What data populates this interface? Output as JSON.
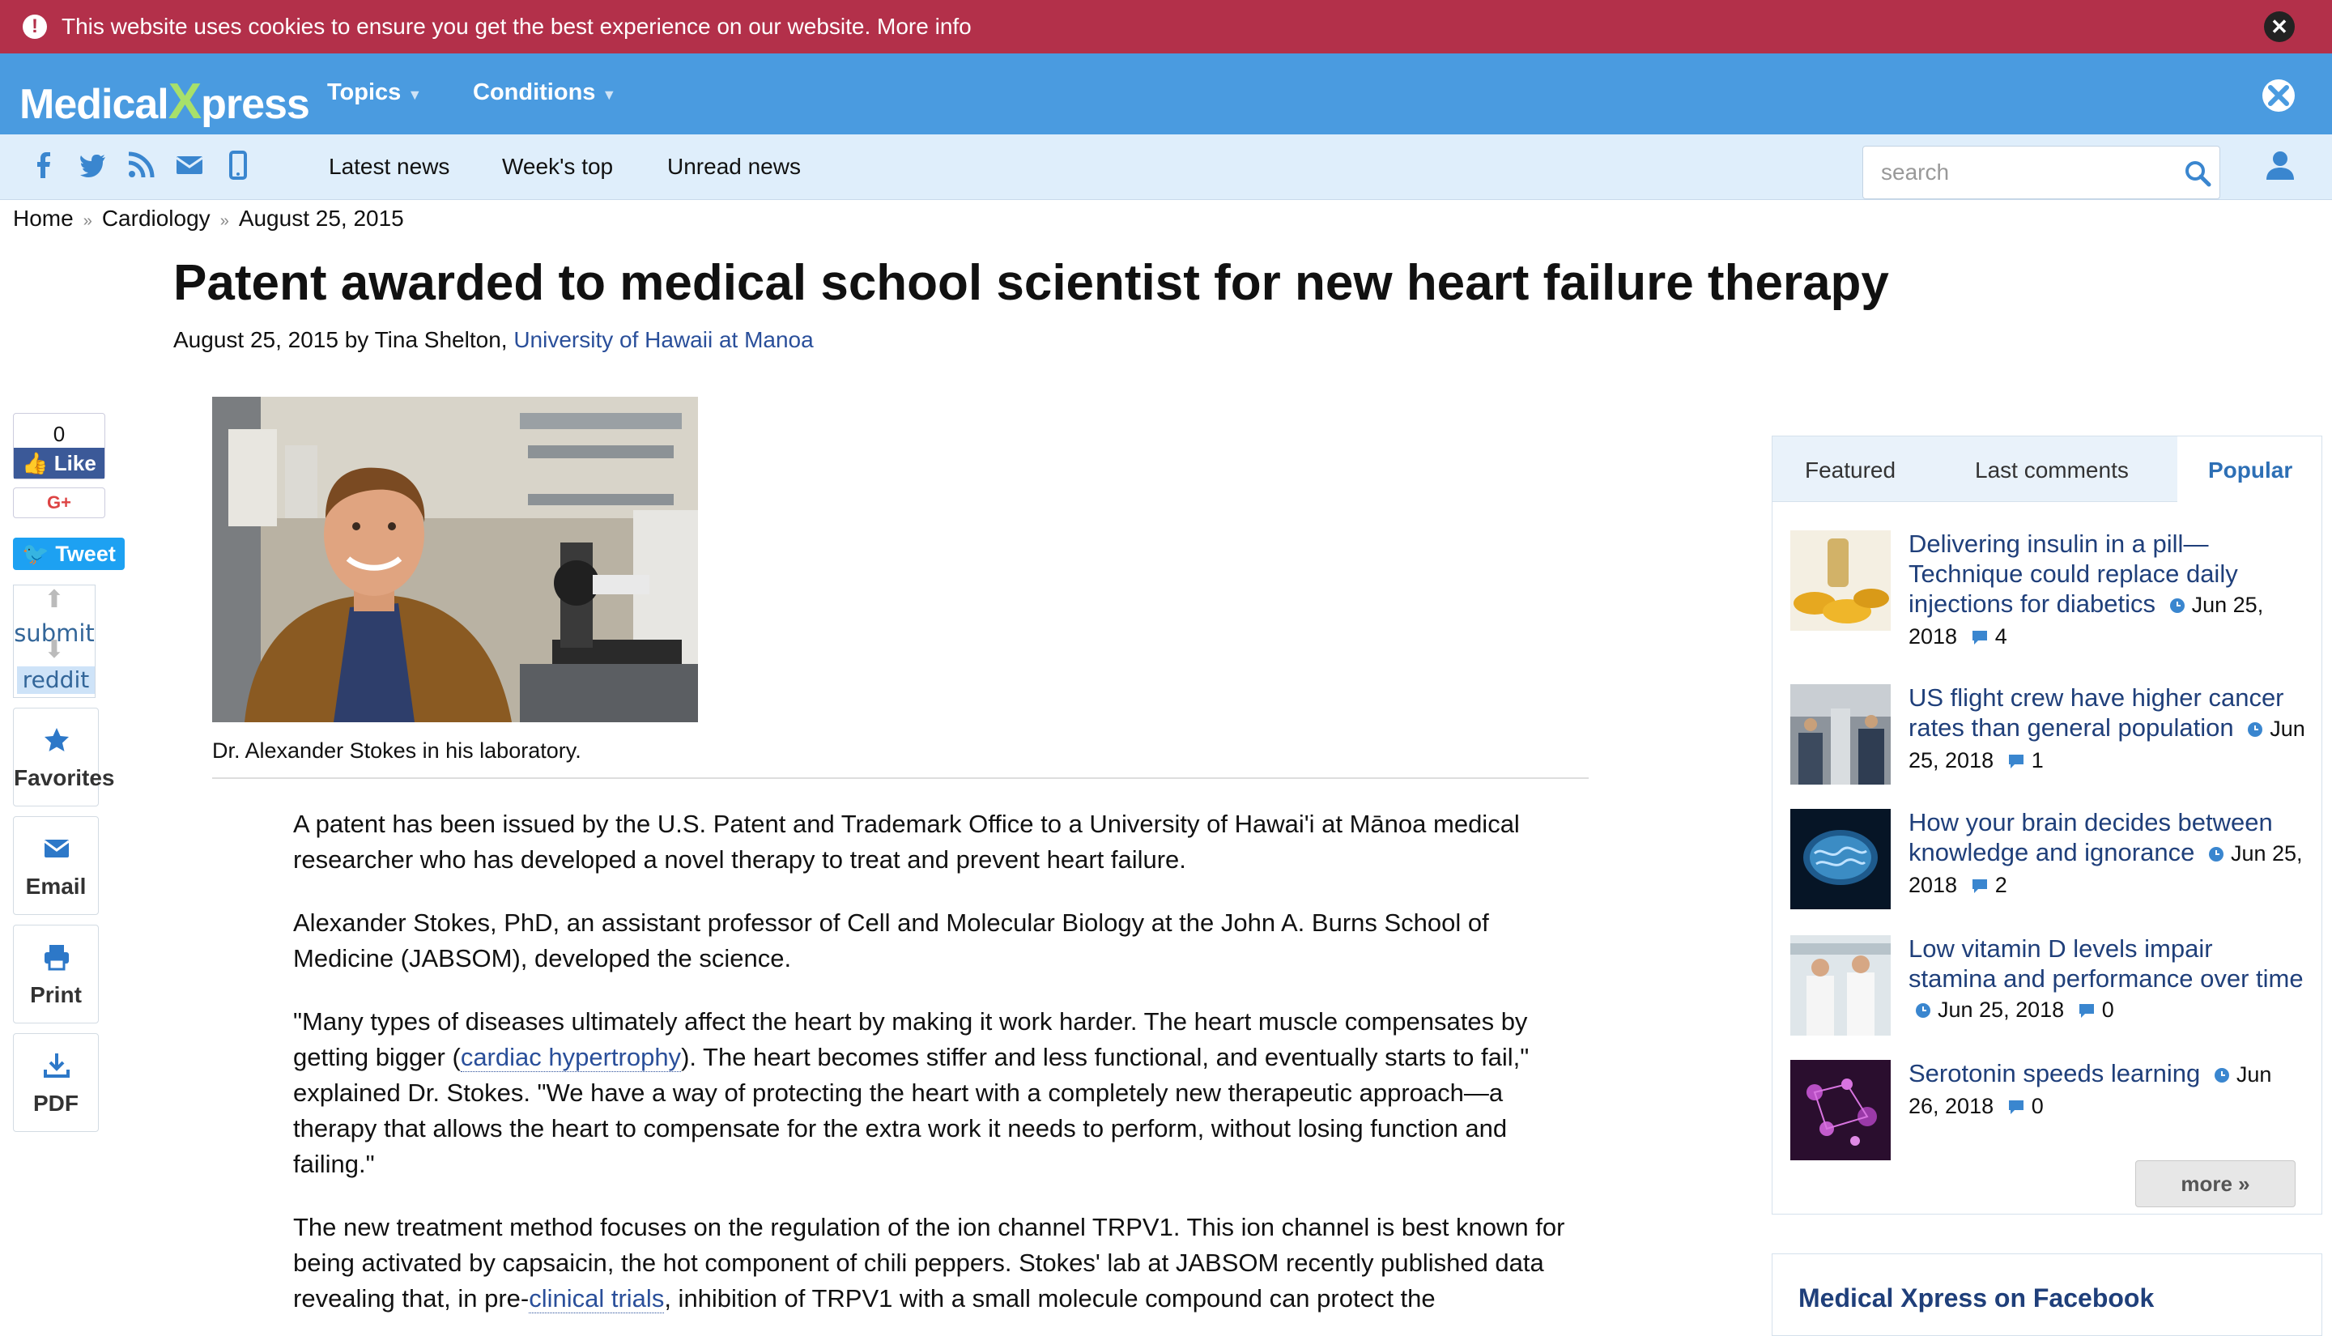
{
  "cookie_bar": {
    "message": "This website uses cookies to ensure you get the best experience on our website.",
    "more_info": "More info"
  },
  "header": {
    "logo_left": "Medical",
    "logo_x": "X",
    "logo_right": "press",
    "nav": [
      {
        "label": "Topics"
      },
      {
        "label": "Conditions"
      }
    ]
  },
  "subnav": {
    "links": [
      {
        "label": "Latest news"
      },
      {
        "label": "Week's top"
      },
      {
        "label": "Unread news"
      }
    ],
    "search_placeholder": "search",
    "social_icons": [
      "facebook-icon",
      "twitter-icon",
      "rss-icon",
      "mail-icon",
      "mobile-icon"
    ]
  },
  "breadcrumb": [
    "Home",
    "Cardiology",
    "August 25, 2015"
  ],
  "article": {
    "title": "Patent awarded to medical school scientist for new heart failure therapy",
    "date": "August 25, 2015",
    "by": "by",
    "author": "Tina Shelton,",
    "institution": "University of Hawaii at Manoa",
    "caption": "Dr. Alexander Stokes in his laboratory.",
    "p1": "A patent has been issued by the U.S. Patent and Trademark Office to a University of Hawai'i at Mānoa medical researcher who has developed a novel therapy to treat and prevent heart failure.",
    "p2": "Alexander Stokes, PhD, an assistant professor of Cell and Molecular Biology at the John A. Burns School of Medicine (JABSOM), developed the science.",
    "p3_a": "\"Many types of diseases ultimately affect the heart by making it work harder. The heart muscle compensates by getting bigger (",
    "p3_link": "cardiac hypertrophy",
    "p3_b": "). The heart becomes stiffer and less functional, and eventually starts to fail,\" explained Dr. Stokes. \"We have a way of protecting the heart with a completely new therapeutic approach—a therapy that allows the heart to compensate for the extra work it needs to perform, without losing function and failing.\"",
    "p4_a": "The new treatment method focuses on the regulation of the ion channel TRPV1. This ion channel is best known for being activated by capsaicin, the hot component of chili peppers. Stokes' lab at JABSOM recently published data revealing that, in pre-",
    "p4_link": "clinical trials",
    "p4_b": ", inhibition of TRPV1 with a small molecule compound can protect the"
  },
  "share": {
    "fb_count": "0",
    "fb_like": "Like",
    "gplus": "G+",
    "tweet": "Tweet",
    "reddit_submit": "submit",
    "reddit_label": "reddit",
    "favorites": "Favorites",
    "email": "Email",
    "print": "Print",
    "pdf": "PDF"
  },
  "sidebar": {
    "tabs": [
      {
        "label": "Featured"
      },
      {
        "label": "Last comments"
      },
      {
        "label": "Popular",
        "active": true
      }
    ],
    "stories": [
      {
        "title": "Delivering insulin in a pill—Technique could replace daily injections for diabetics",
        "date": "Jun 25, 2018",
        "comments": "4"
      },
      {
        "title": "US flight crew have higher cancer rates than general population",
        "date": "Jun 25, 2018",
        "comments": "1"
      },
      {
        "title": "How your brain decides between knowledge and ignorance",
        "date": "Jun 25, 2018",
        "comments": "2"
      },
      {
        "title": "Low vitamin D levels impair stamina and performance over time",
        "date": "Jun 25, 2018",
        "comments": "0"
      },
      {
        "title": "Serotonin speeds learning",
        "date": "Jun 26, 2018",
        "comments": "0"
      }
    ],
    "more": "more »",
    "facebook_widget_title": "Medical Xpress on Facebook"
  },
  "colors": {
    "cookie_bar": "#b3304a",
    "header": "#4a9be0",
    "subnav": "#dfeefb",
    "link": "#2a4f9a",
    "sidebar_link": "#1f3f7a"
  }
}
